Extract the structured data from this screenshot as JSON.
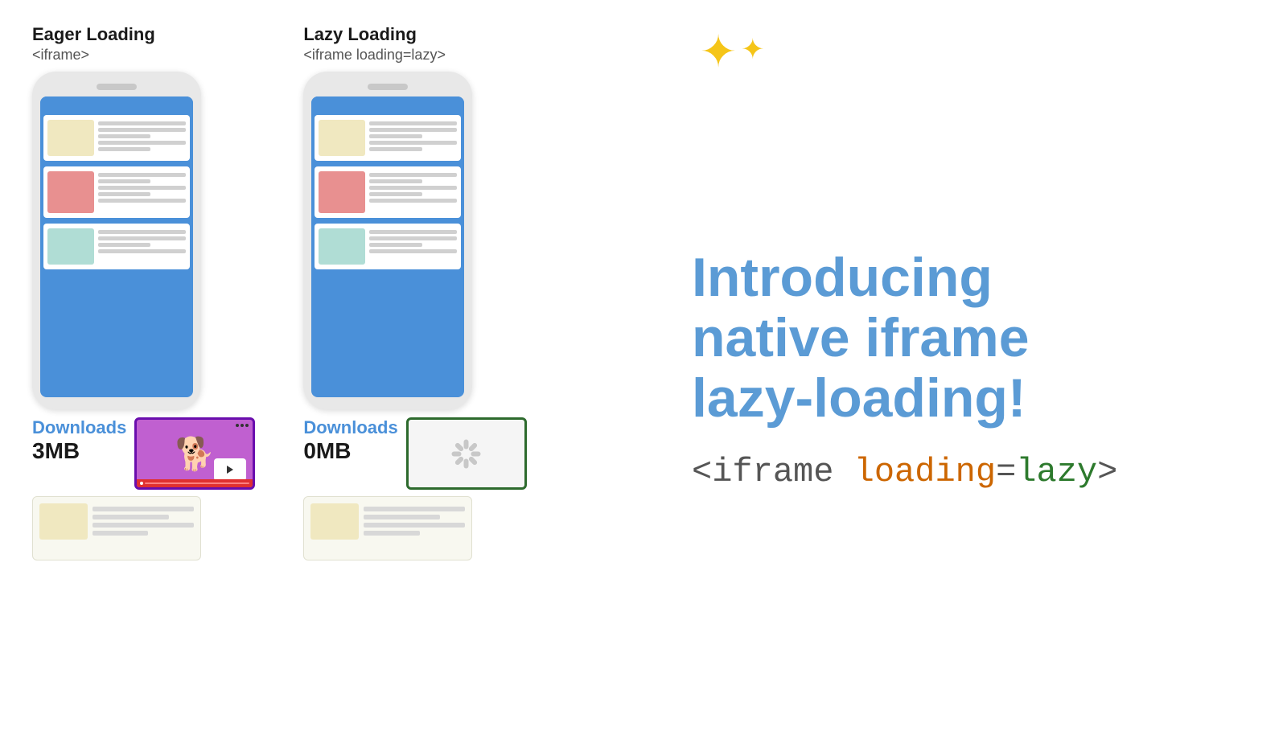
{
  "eager": {
    "title": "Eager Loading",
    "code": "<iframe>",
    "downloads_label": "Downloads",
    "downloads_size": "3MB"
  },
  "lazy": {
    "title": "Lazy Loading",
    "code": "<iframe loading=lazy>",
    "downloads_label": "Downloads",
    "downloads_size": "0MB"
  },
  "right": {
    "headline_line1": "Introducing",
    "headline_line2": "native iframe",
    "headline_line3": "lazy-loading!",
    "code_part1": "<iframe ",
    "code_part2": "loading",
    "code_part3": "=",
    "code_part4": "lazy",
    "code_part5": ">"
  },
  "sparkle": "✦✦"
}
